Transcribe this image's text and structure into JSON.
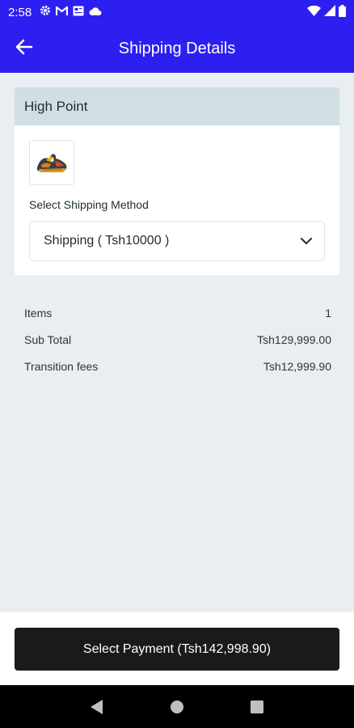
{
  "status_bar": {
    "time": "2:58",
    "icons": [
      "gear-icon",
      "gmail-icon",
      "news-icon",
      "cloud-icon",
      "wifi-icon",
      "signal-icon",
      "battery-icon"
    ]
  },
  "app_bar": {
    "title": "Shipping Details",
    "back_icon": "arrow-left-icon"
  },
  "store_card": {
    "store_name": "High Point",
    "product_image": "sneaker-image",
    "shipping_label": "Select Shipping Method",
    "shipping_selected": "Shipping ( Tsh10000 )"
  },
  "summary": {
    "rows": [
      {
        "label": "Items",
        "value": "1"
      },
      {
        "label": "Sub Total",
        "value": "Tsh129,999.00"
      },
      {
        "label": "Transition fees",
        "value": "Tsh12,999.90"
      }
    ]
  },
  "payment_button": {
    "label": "Select Payment (Tsh142,998.90)"
  },
  "nav_bar": {
    "buttons": [
      "back-triangle-icon",
      "home-circle-icon",
      "recents-square-icon"
    ]
  },
  "colors": {
    "primary": "#2d1ff0",
    "background": "#e8eef1",
    "card_header": "#d1dee3",
    "button": "#1a1a1a"
  }
}
